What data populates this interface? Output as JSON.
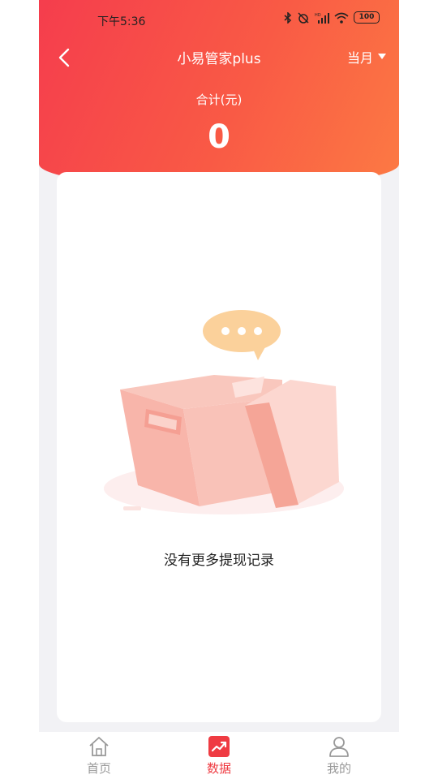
{
  "status_bar": {
    "time": "下午5:36",
    "battery": "100"
  },
  "header": {
    "title": "小易管家plus",
    "period": "当月",
    "total_label": "合计(元)",
    "total_value": "0"
  },
  "empty_state": {
    "message": "没有更多提现记录"
  },
  "tabbar": {
    "items": [
      {
        "label": "首页",
        "icon": "home-icon",
        "active": false
      },
      {
        "label": "数据",
        "icon": "chart-trend-icon",
        "active": true
      },
      {
        "label": "我的",
        "icon": "user-icon",
        "active": false
      }
    ]
  },
  "colors": {
    "header_gradient_start": "#f53d4d",
    "header_gradient_end": "#fc7a44",
    "accent": "#ef3b42",
    "inactive_tab": "#999999",
    "box": "#f8b5aa",
    "bubble": "#fbd19b"
  }
}
